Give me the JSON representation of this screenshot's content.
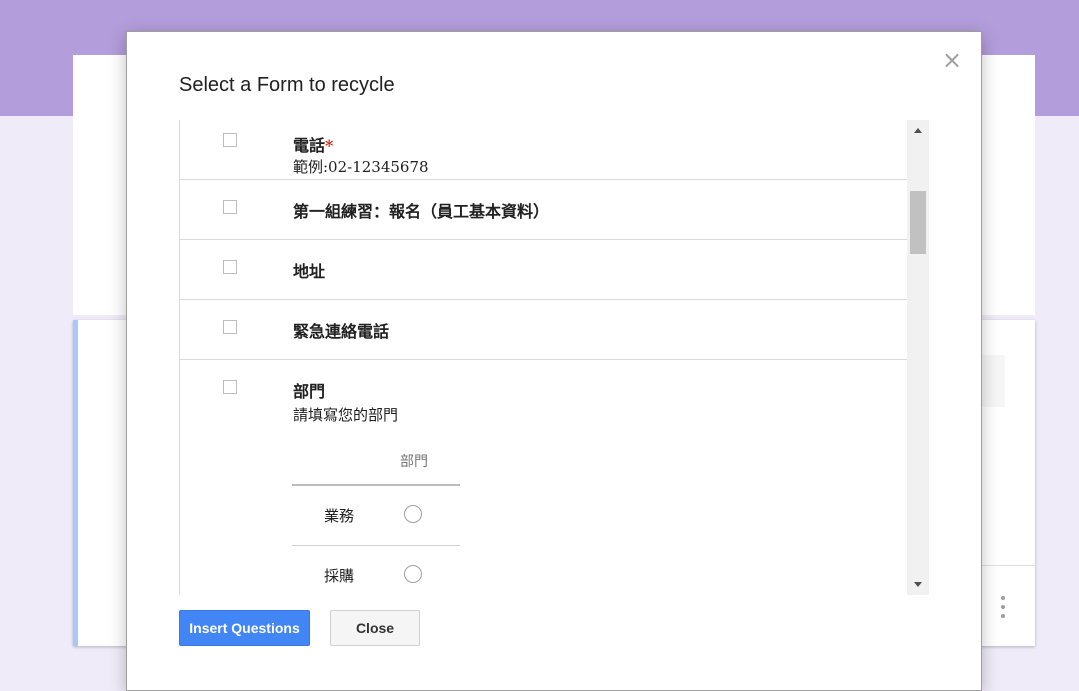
{
  "dialog": {
    "title": "Select a Form to recycle",
    "close_icon": "×",
    "insert_label": "Insert Questions",
    "close_label": "Close"
  },
  "questions": [
    {
      "title": "電話",
      "required_mark": "*",
      "description": "範例:02-12345678"
    },
    {
      "title": "第一組練習：報名（員工基本資料）"
    },
    {
      "title": "地址"
    },
    {
      "title": "緊急連絡電話"
    },
    {
      "title": "部門",
      "description": "請填寫您的部門",
      "grid": {
        "column": "部門",
        "rows": [
          "業務",
          "採購"
        ]
      }
    }
  ],
  "colors": {
    "accent_purple": "#b39ddb",
    "primary_button": "#4285f4",
    "required": "#d93025"
  },
  "icons": [
    "close-icon",
    "kebab-menu-icon",
    "scroll-up-arrow-icon",
    "scroll-down-arrow-icon"
  ]
}
